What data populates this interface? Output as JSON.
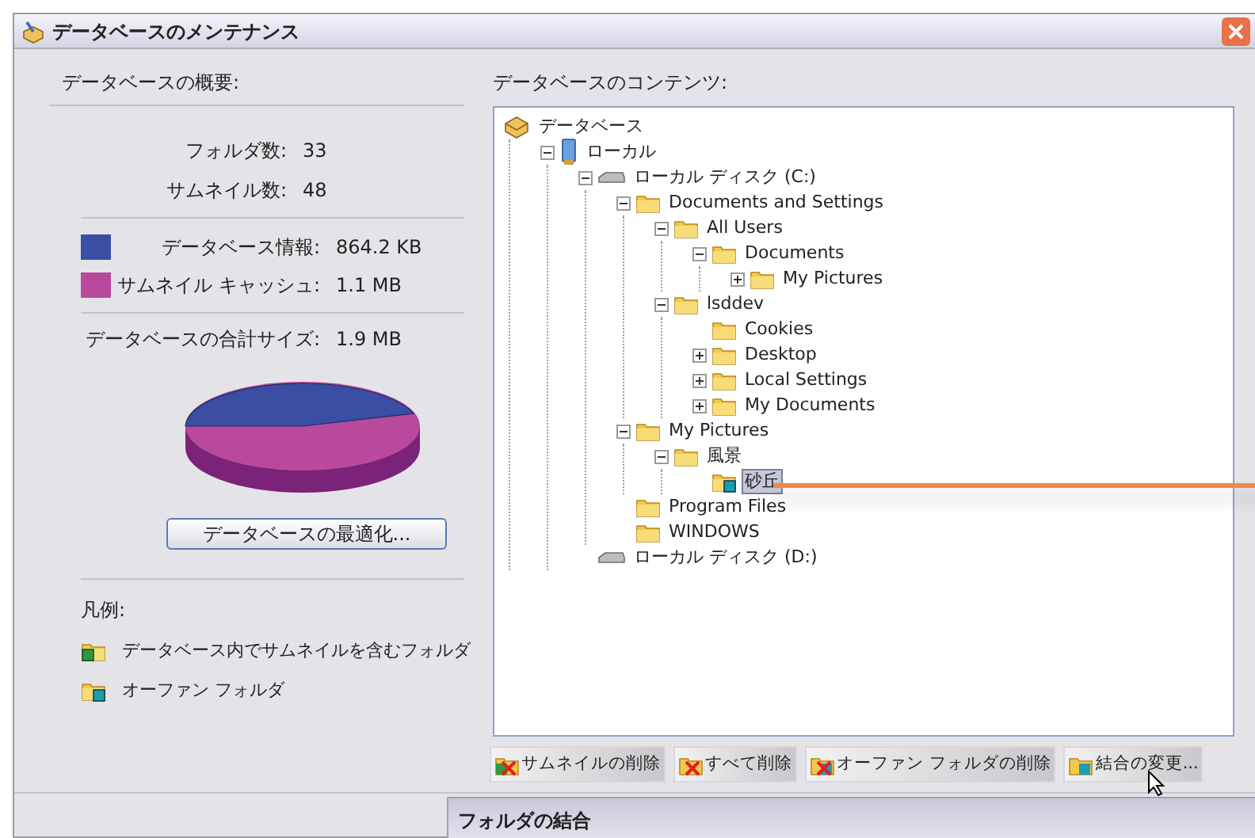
{
  "window": {
    "title": "データベースのメンテナンス"
  },
  "summary": {
    "heading": "データベースの概要:",
    "counts": [
      {
        "label": "フォルダ数:",
        "value": "33"
      },
      {
        "label": "サムネイル数:",
        "value": "48"
      }
    ],
    "sizes": [
      {
        "label": "データベース情報:",
        "value": "864.2 KB",
        "color": "#3a4ea3"
      },
      {
        "label": "サムネイル キャッシュ:",
        "value": "1.1 MB",
        "color": "#b8499c"
      }
    ],
    "total": {
      "label": "データベースの合計サイズ:",
      "value": "1.9 MB"
    },
    "optimize_button": "データベースの最適化..."
  },
  "legend": {
    "heading": "凡例:",
    "items": [
      {
        "kind": "thumbs",
        "label": "データベース内でサムネイルを含むフォルダ"
      },
      {
        "kind": "orphan",
        "label": "オーファン フォルダ"
      }
    ]
  },
  "contents": {
    "heading": "データベースのコンテンツ:",
    "tree": [
      {
        "label": "データベース",
        "kind": "database",
        "selected": false,
        "children": [
          {
            "label": "ローカル",
            "kind": "computer",
            "expanded": true,
            "selected": false,
            "children": [
              {
                "label": "ローカル ディスク (C:)",
                "kind": "drive",
                "expanded": true,
                "selected": false,
                "children": [
                  {
                    "label": "Documents and Settings",
                    "kind": "folder",
                    "expanded": true,
                    "selected": false,
                    "children": [
                      {
                        "label": "All Users",
                        "kind": "folder",
                        "expanded": true,
                        "selected": false,
                        "children": [
                          {
                            "label": "Documents",
                            "kind": "folder",
                            "expanded": true,
                            "selected": false,
                            "children": [
                              {
                                "label": "My Pictures",
                                "kind": "folder",
                                "expanded": false,
                                "selected": false
                              }
                            ]
                          }
                        ]
                      },
                      {
                        "label": "lsddev",
                        "kind": "folder",
                        "expanded": true,
                        "selected": false,
                        "children": [
                          {
                            "label": "Cookies",
                            "kind": "folder",
                            "selected": false
                          },
                          {
                            "label": "Desktop",
                            "kind": "folder",
                            "expanded": false,
                            "selected": false
                          },
                          {
                            "label": "Local Settings",
                            "kind": "folder",
                            "expanded": false,
                            "selected": false
                          },
                          {
                            "label": "My Documents",
                            "kind": "folder",
                            "expanded": false,
                            "selected": false
                          }
                        ]
                      }
                    ]
                  },
                  {
                    "label": "My Pictures",
                    "kind": "folder",
                    "expanded": true,
                    "selected": false,
                    "children": [
                      {
                        "label": "風景",
                        "kind": "folder",
                        "expanded": true,
                        "selected": false,
                        "children": [
                          {
                            "label": "砂丘",
                            "kind": "orphan",
                            "selected": true
                          }
                        ]
                      }
                    ]
                  },
                  {
                    "label": "Program Files",
                    "kind": "folder",
                    "selected": false
                  },
                  {
                    "label": "WINDOWS",
                    "kind": "folder",
                    "selected": false
                  }
                ]
              },
              {
                "label": "ローカル ディスク (D:)",
                "kind": "drive",
                "selected": false
              }
            ]
          }
        ]
      }
    ],
    "buttons": [
      {
        "kind": "delete_thumbs",
        "label": "サムネイルの削除"
      },
      {
        "kind": "delete_all",
        "label": "すべて削除"
      },
      {
        "kind": "delete_orphan",
        "label": "オーファン フォルダの削除"
      },
      {
        "kind": "change_link",
        "label": "結合の変更..."
      }
    ]
  },
  "subwindow": {
    "title": "フォルダの結合"
  }
}
